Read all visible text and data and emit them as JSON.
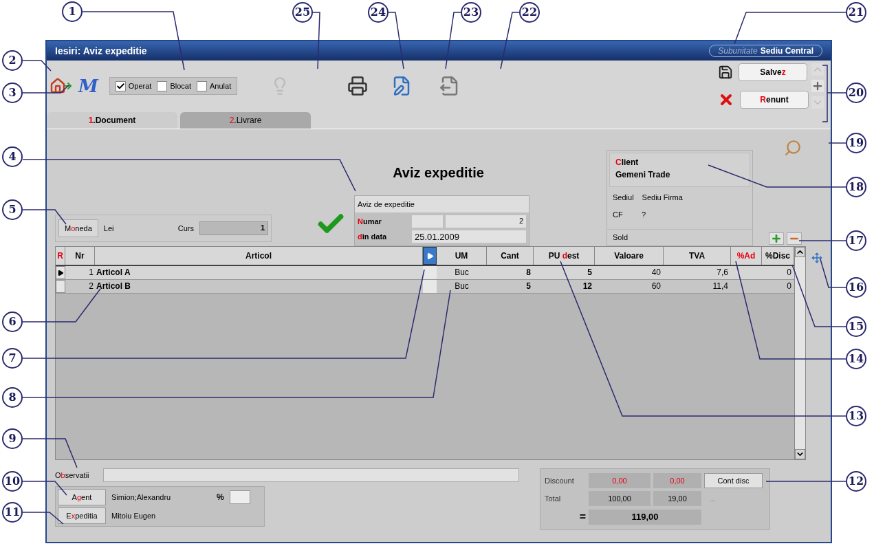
{
  "window": {
    "title": "Iesiri: Aviz expeditie",
    "subunit_label": "Subunitate",
    "subunit_value": "Sediu Central"
  },
  "toolbar": {
    "logo": "M",
    "status_checks": [
      {
        "label": "Operat",
        "checked": true
      },
      {
        "label": "Blocat",
        "checked": false
      },
      {
        "label": "Anulat",
        "checked": false
      }
    ]
  },
  "actions": [
    {
      "kind": "save",
      "label": {
        "pre": "Salve",
        "key": "z"
      }
    },
    {
      "kind": "cancel",
      "label": {
        "key": "R",
        "post": "enunt"
      }
    }
  ],
  "tabs": [
    {
      "label": {
        "key": "1",
        "post": ".Document"
      },
      "selected": true
    },
    {
      "label": {
        "key": "2",
        "post": ".Livrare"
      },
      "selected": false
    }
  ],
  "document": {
    "heading": "Aviz expeditie",
    "type_label": "Aviz de expeditie",
    "number_label": {
      "key": "N",
      "post": "umar"
    },
    "number": "2",
    "date_label": {
      "key": "d",
      "post": "in data"
    },
    "date": "25.01.2009",
    "validated": true
  },
  "currency": {
    "button": {
      "pre": "M",
      "key": "o",
      "post": "neda"
    },
    "value": "Lei",
    "rate_label": "Curs",
    "rate": "1"
  },
  "client": {
    "label": {
      "key": "C",
      "post": "lient"
    },
    "name": "Gemeni Trade",
    "office_label": "Sediul",
    "office": "Sediu Firma",
    "cf_label": "CF",
    "cf": "?",
    "balance_label": "Sold"
  },
  "table": {
    "columns": [
      {
        "key": "R"
      },
      {
        "pre": "Nr"
      },
      {
        "pre": "Articol"
      },
      {
        "pre": "UM"
      },
      {
        "pre": "Cant"
      },
      {
        "pre": "PU ",
        "key": "d",
        "post": "est"
      },
      {
        "pre": "Valoare"
      },
      {
        "pre": "TVA"
      },
      {
        "key": "%Ad"
      },
      {
        "pre": "%Disc"
      }
    ],
    "rows": [
      {
        "current": true,
        "nr": "1",
        "article": "Articol A",
        "um": "Buc",
        "qty": "8",
        "price": "5",
        "value": "40",
        "vat": "7,6",
        "discount": "0"
      },
      {
        "current": false,
        "nr": "2",
        "article": "Articol B",
        "um": "Buc",
        "qty": "5",
        "price": "12",
        "value": "60",
        "vat": "11,4",
        "discount": "0"
      }
    ]
  },
  "observations": {
    "label": {
      "key": "O",
      "mid": "b",
      "post": "servatii"
    }
  },
  "agent": {
    "button": {
      "pre": "A",
      "key": "g",
      "post": "ent"
    },
    "name": "Simion;Alexandru",
    "percent_symbol": "%"
  },
  "delegate": {
    "button": {
      "pre": "E",
      "key": "x",
      "post": "peditia"
    },
    "name": "Mitoiu Eugen"
  },
  "totals": {
    "discount_label": "Discount",
    "discount_value": "0,00",
    "discount_vat": "0,00",
    "discount_button": "Cont disc",
    "total_label": "Total",
    "total_value": "100,00",
    "total_vat": "19,00",
    "extra": "...",
    "equals": "=",
    "grand_total": "119,00"
  },
  "callouts": [
    "1",
    "25",
    "24",
    "23",
    "22",
    "21",
    "2",
    "3",
    "20",
    "19",
    "4",
    "18",
    "5",
    "17",
    "16",
    "6",
    "15",
    "7",
    "14",
    "8",
    "13",
    "9",
    "10",
    "12",
    "11"
  ]
}
